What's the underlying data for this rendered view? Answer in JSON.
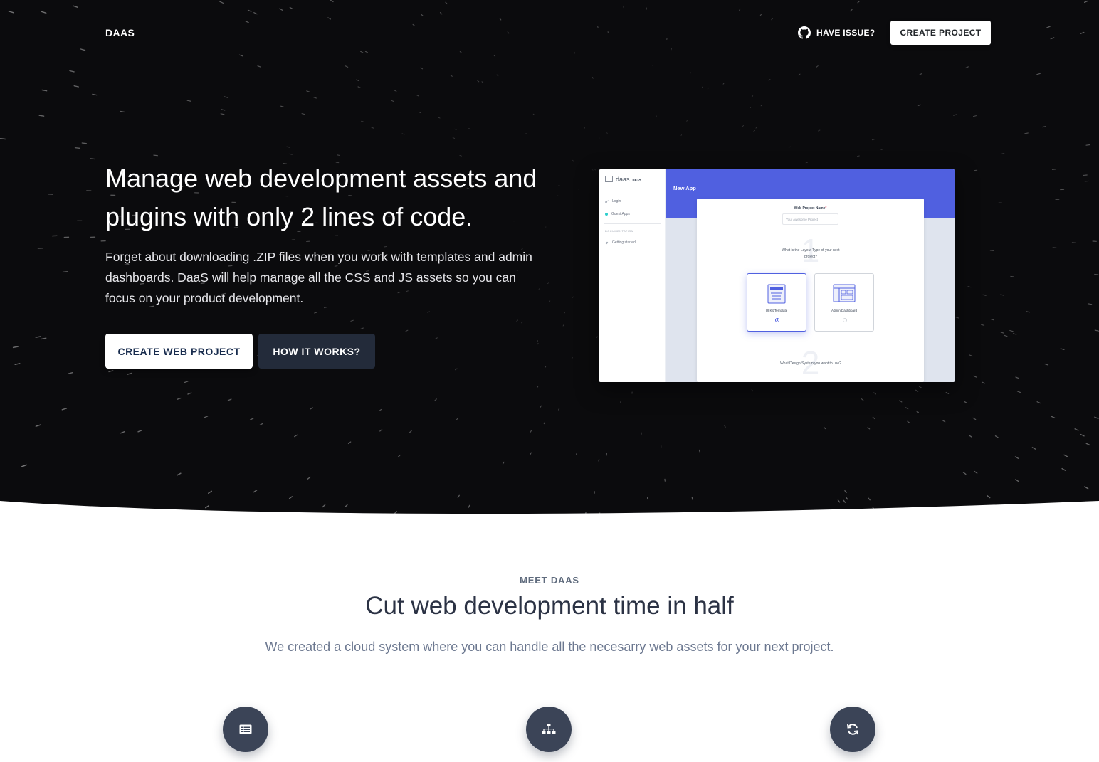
{
  "nav": {
    "brand": "DAAS",
    "issue_label": "HAVE ISSUE?",
    "create_label": "CREATE PROJECT"
  },
  "hero": {
    "title": "Manage web development assets and plugins with only 2 lines of code.",
    "description": "Forget about downloading .ZIP files when you work with templates and admin dashboards. DaaS will help manage all the CSS and JS assets so you can focus on your product development.",
    "primary_button": "CREATE WEB PROJECT",
    "secondary_button": "HOW IT WORKS?"
  },
  "preview": {
    "logo": "daas",
    "badge": "BETA",
    "nav_items": [
      "Login",
      "Guest Apps"
    ],
    "section_label": "DOCUMENTATION",
    "doc_items": [
      "Getting started"
    ],
    "header_title": "New App",
    "field_label": "Web Project Name",
    "field_required_mark": "*",
    "field_placeholder": "Your Awesome Project",
    "step1_number": "1",
    "step1_question": "What is the Layout Type of your next project?",
    "options": [
      {
        "label": "UI Kit/Template",
        "selected": true
      },
      {
        "label": "Admin Dashboard",
        "selected": false
      }
    ],
    "step2_number": "2",
    "step2_question": "What Design System you want to use?"
  },
  "meet": {
    "eyebrow": "MEET DAAS",
    "title": "Cut web development time in half",
    "description": "We created a cloud system where you can handle all the necesarry web assets for your next project."
  },
  "features": [
    {
      "icon": "list-icon"
    },
    {
      "icon": "sitemap-icon"
    },
    {
      "icon": "sync-icon"
    }
  ],
  "colors": {
    "hero_bg": "#0b0b0d",
    "preview_accent": "#5060e0",
    "feature_icon_bg": "#3b4457",
    "secondary_button_bg": "#232b3a"
  }
}
